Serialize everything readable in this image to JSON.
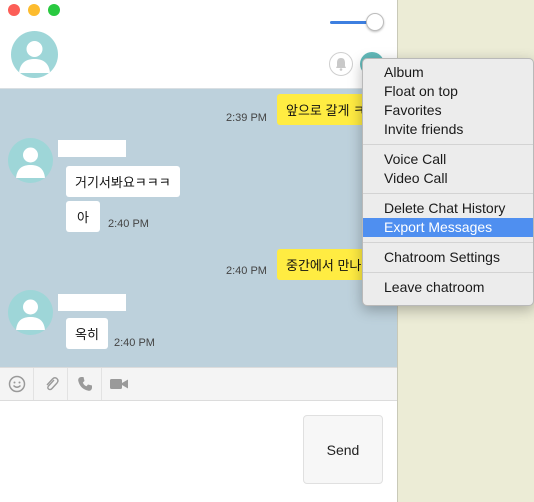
{
  "header": {
    "window_buttons": [
      "close",
      "minimize",
      "zoom"
    ]
  },
  "colors": {
    "chat_background": "#bdd1dc",
    "my_bubble": "#ffec42",
    "other_bubble": "#ffffff",
    "menu_highlight": "#4f8ff0",
    "avatar": "#9ed6d8"
  },
  "messages": [
    {
      "from": "me",
      "text": "앞으로 갈게 ㅋ",
      "time": "2:39 PM"
    },
    {
      "from": "other",
      "text": "거기서봐요ㅋㅋㅋ",
      "time": ""
    },
    {
      "from": "other",
      "text": "아",
      "time": "2:40 PM"
    },
    {
      "from": "me",
      "text": "중간에서 만나",
      "time": "2:40 PM"
    },
    {
      "from": "other",
      "text": "옥히",
      "time": "2:40 PM"
    }
  ],
  "toolbar": {
    "icons": [
      "emoji-icon",
      "attachment-icon",
      "phone-icon",
      "video-icon"
    ]
  },
  "composer": {
    "send_label": "Send"
  },
  "context_menu": {
    "groups": [
      [
        "Album",
        "Float on top",
        "Favorites",
        "Invite friends"
      ],
      [
        "Voice Call",
        "Video Call"
      ],
      [
        "Delete Chat History",
        "Export Messages"
      ],
      [
        "Chatroom Settings"
      ],
      [
        "Leave chatroom"
      ]
    ],
    "highlighted": "Export Messages"
  }
}
